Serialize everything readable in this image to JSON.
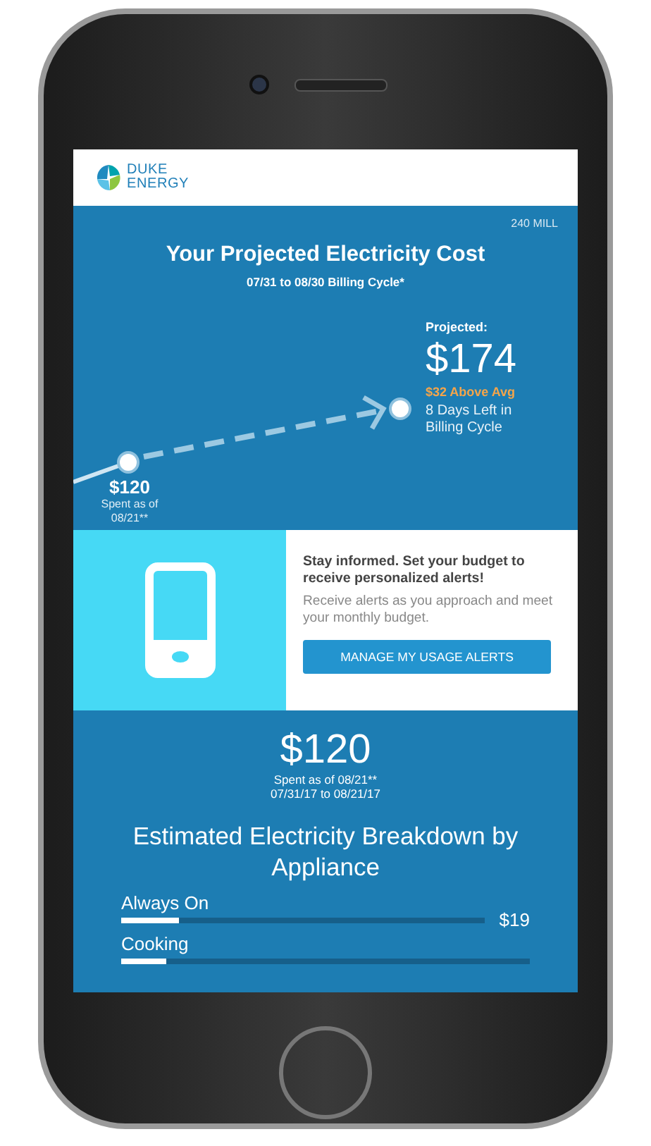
{
  "header": {
    "logo_lines": [
      "DUKE",
      "ENERGY"
    ]
  },
  "account": "240 MILL",
  "projection": {
    "title": "Your Projected Electricity Cost",
    "subtitle": "07/31 to 08/30 Billing Cycle*",
    "spent": {
      "amount": "$120",
      "caption": "Spent as of 08/21**"
    },
    "projected": {
      "label": "Projected:",
      "amount": "$174",
      "comparison": "$32 Above Avg",
      "days_left": "8 Days Left in Billing Cycle"
    }
  },
  "alerts": {
    "heading": "Stay informed. Set your budget to receive personalized alerts!",
    "body": "Receive alerts as you approach and meet your monthly budget.",
    "button": "MANAGE MY USAGE ALERTS"
  },
  "summary": {
    "amount": "$120",
    "caption": "Spent as of 08/21**",
    "date_range": "07/31/17 to 08/21/17"
  },
  "breakdown": {
    "title": "Estimated Electricity Breakdown by Appliance",
    "items": [
      {
        "name": "Always On",
        "level": 0.16,
        "amount": "$19"
      },
      {
        "name": "Cooking",
        "level": 0.11
      }
    ]
  }
}
